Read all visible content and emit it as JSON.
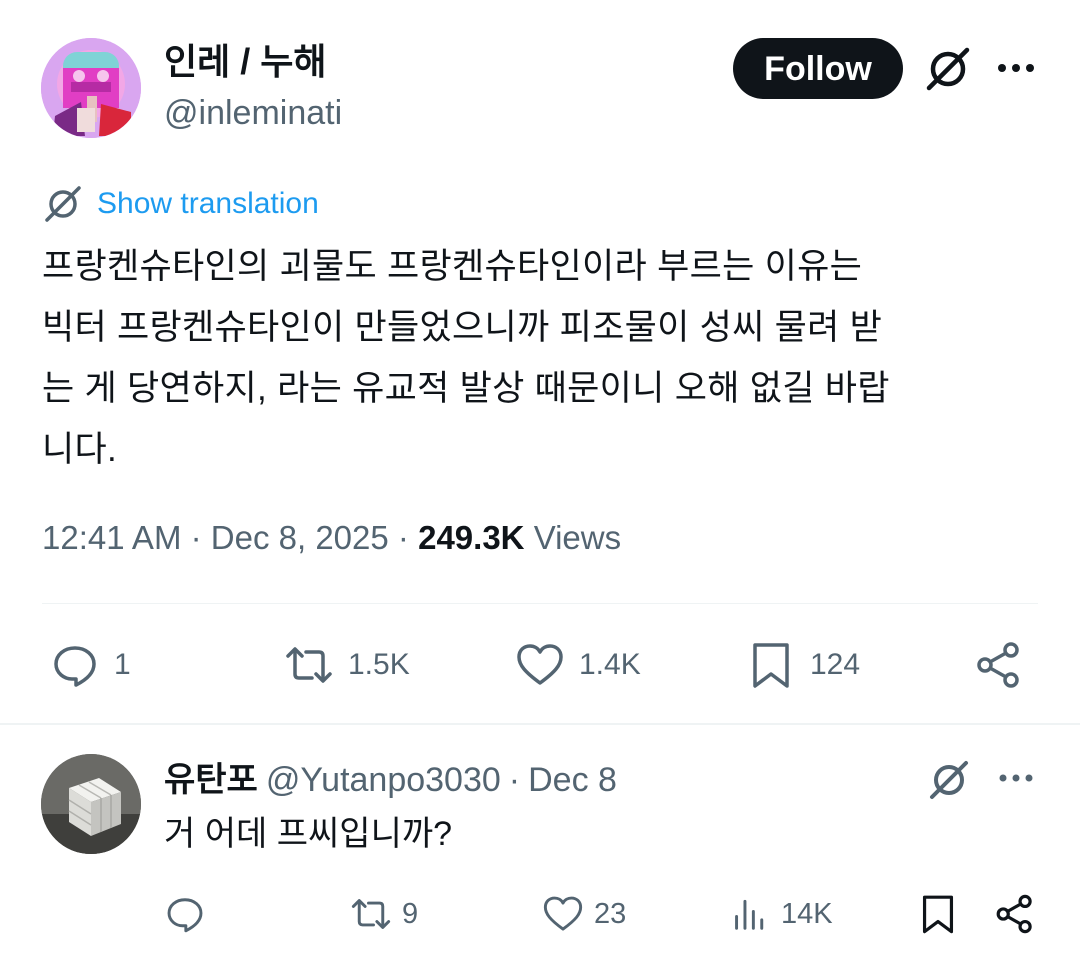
{
  "post": {
    "author": {
      "name": "인레 / 누해",
      "handle": "@inleminati"
    },
    "follow_label": "Follow",
    "translate_label": "Show translation",
    "text_lines": [
      "프랑켄슈타인의 괴물도 프랑켄슈타인이라 부르는 이유는",
      "빅터 프랑켄슈타인이 만들었으니까 피조물이 성씨 물려 받",
      "는 게 당연하지, 라는 유교적 발상 때문이니 오해 없길 바랍",
      "니다."
    ],
    "time": "12:41 AM",
    "separator": "·",
    "date": "Dec 8, 2025",
    "views_count": "249.3K",
    "views_label": "Views",
    "actions": {
      "replies": "1",
      "reposts": "1.5K",
      "likes": "1.4K",
      "bookmarks": "124"
    }
  },
  "reply": {
    "name": "유탄포",
    "handle": "@Yutanpo3030",
    "separator": "·",
    "date": "Dec 8",
    "text": "거 어데 프씨입니까?",
    "actions": {
      "replies": "",
      "reposts": "9",
      "likes": "23",
      "views": "14K",
      "bookmarks": ""
    }
  },
  "icons": {
    "grok": "grok-icon",
    "more": "more-icon",
    "reply": "reply-icon",
    "repost": "repost-icon",
    "like": "heart-icon",
    "bookmark": "bookmark-icon",
    "share": "share-icon",
    "views": "analytics-icon"
  },
  "colors": {
    "text": "#0f1419",
    "muted": "#536471",
    "link": "#1d9bf0",
    "follow_bg": "#0f1419",
    "divider": "#eff3f4"
  }
}
